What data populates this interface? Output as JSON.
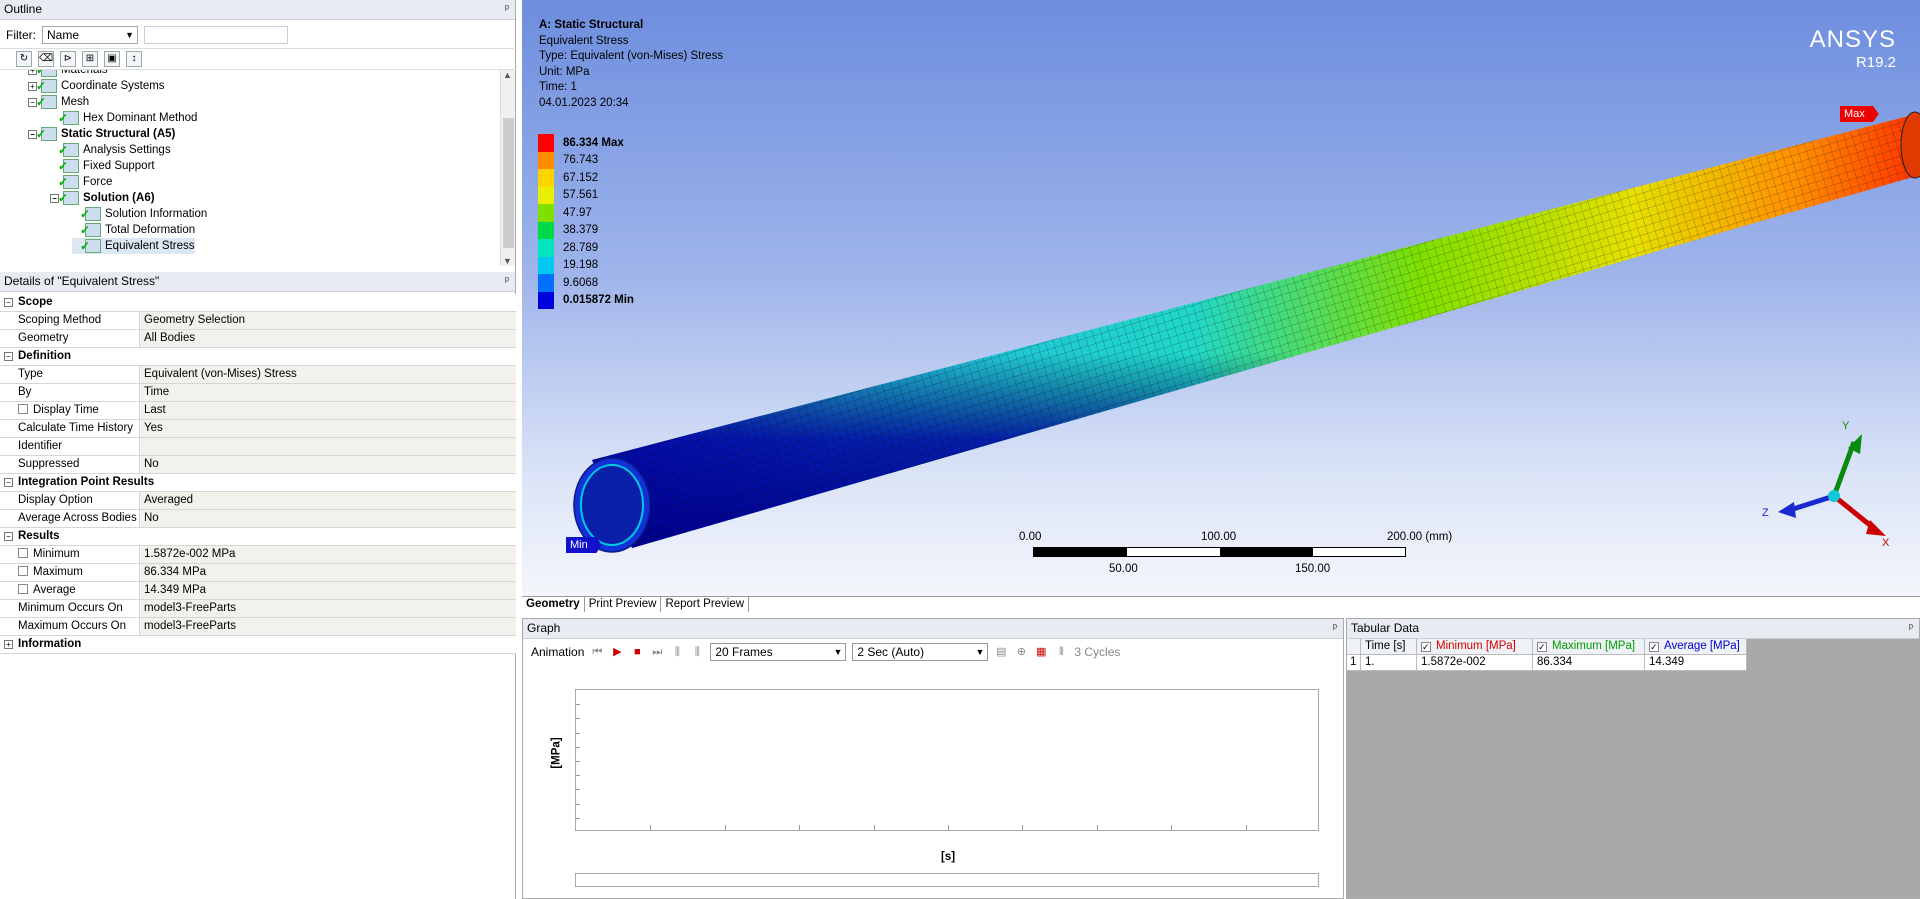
{
  "outline": {
    "title": "Outline",
    "filter_label": "Filter:",
    "filter_value": "Name",
    "tree": [
      {
        "label": "Materials",
        "level": 2,
        "expander": "+",
        "bold": false
      },
      {
        "label": "Coordinate Systems",
        "level": 2,
        "expander": "+",
        "bold": false
      },
      {
        "label": "Mesh",
        "level": 2,
        "expander": "−",
        "bold": false
      },
      {
        "label": "Hex Dominant Method",
        "level": 3,
        "expander": "",
        "bold": false
      },
      {
        "label": "Static Structural (A5)",
        "level": 2,
        "expander": "−",
        "bold": true
      },
      {
        "label": "Analysis Settings",
        "level": 3,
        "expander": "",
        "bold": false
      },
      {
        "label": "Fixed Support",
        "level": 3,
        "expander": "",
        "bold": false
      },
      {
        "label": "Force",
        "level": 3,
        "expander": "",
        "bold": false
      },
      {
        "label": "Solution (A6)",
        "level": 3,
        "expander": "−",
        "bold": true
      },
      {
        "label": "Solution Information",
        "level": 4,
        "expander": "",
        "bold": false
      },
      {
        "label": "Total Deformation",
        "level": 4,
        "expander": "",
        "bold": false
      },
      {
        "label": "Equivalent Stress",
        "level": 4,
        "expander": "",
        "bold": false
      }
    ]
  },
  "details": {
    "title": "Details of \"Equivalent Stress\"",
    "rows": [
      {
        "group": "Scope"
      },
      {
        "k": "Scoping Method",
        "v": "Geometry Selection"
      },
      {
        "k": "Geometry",
        "v": "All Bodies"
      },
      {
        "group": "Definition"
      },
      {
        "k": "Type",
        "v": "Equivalent (von-Mises) Stress"
      },
      {
        "k": "By",
        "v": "Time"
      },
      {
        "k": "Display Time",
        "v": "Last",
        "cb": true
      },
      {
        "k": "Calculate Time History",
        "v": "Yes"
      },
      {
        "k": "Identifier",
        "v": ""
      },
      {
        "k": "Suppressed",
        "v": "No"
      },
      {
        "group": "Integration Point Results"
      },
      {
        "k": "Display Option",
        "v": "Averaged"
      },
      {
        "k": "Average Across Bodies",
        "v": "No"
      },
      {
        "group": "Results"
      },
      {
        "k": "Minimum",
        "v": "1.5872e-002 MPa",
        "cb": true
      },
      {
        "k": "Maximum",
        "v": "86.334 MPa",
        "cb": true
      },
      {
        "k": "Average",
        "v": "14.349 MPa",
        "cb": true
      },
      {
        "k": "Minimum Occurs On",
        "v": "model3-FreeParts"
      },
      {
        "k": "Maximum Occurs On",
        "v": "model3-FreeParts"
      },
      {
        "group": "Information",
        "collapsed": true
      }
    ]
  },
  "viewport": {
    "info": {
      "title": "A: Static Structural",
      "line1": "Equivalent Stress",
      "line2": "Type: Equivalent (von-Mises) Stress",
      "line3": "Unit: MPa",
      "line4": "Time: 1",
      "line5": "04.01.2023 20:34"
    },
    "brand": "ANSYS",
    "version": "R19.2",
    "legend": [
      {
        "label": "86.334 Max",
        "color": "#ff0000"
      },
      {
        "label": "76.743",
        "color": "#ff8c00"
      },
      {
        "label": "67.152",
        "color": "#ffd400"
      },
      {
        "label": "57.561",
        "color": "#e6f000"
      },
      {
        "label": "47.97",
        "color": "#7fe000"
      },
      {
        "label": "38.379",
        "color": "#00d84a"
      },
      {
        "label": "28.789",
        "color": "#00e6c0"
      },
      {
        "label": "19.198",
        "color": "#00c8f0"
      },
      {
        "label": "9.6068",
        "color": "#0070ff"
      },
      {
        "label": "0.015872 Min",
        "color": "#0000e0"
      }
    ],
    "max_tag": "Max",
    "min_tag": "Min",
    "scale": {
      "t0": "0.00",
      "t100": "100.00",
      "t200": "200.00 (mm)",
      "t50": "50.00",
      "t150": "150.00"
    },
    "axes": {
      "x": "X",
      "y": "Y",
      "z": "Z"
    }
  },
  "tabs": [
    "Geometry",
    "Print Preview",
    "Report Preview"
  ],
  "graph": {
    "title": "Graph",
    "animation": "Animation",
    "frames": "20 Frames",
    "duration": "2 Sec (Auto)",
    "cycles": "3 Cycles",
    "ylabel": "[MPa]",
    "xlabel": "[s]"
  },
  "tabular": {
    "title": "Tabular Data",
    "headers": [
      "Time [s]",
      "Minimum [MPa]",
      "Maximum [MPa]",
      "Average [MPa]"
    ],
    "header_colors": [
      "#000000",
      "#d40000",
      "#00a000",
      "#0000d0"
    ],
    "rows": [
      {
        "idx": "1",
        "time": "1.",
        "min": "1.5872e-002",
        "max": "86.334",
        "avg": "14.349"
      }
    ]
  }
}
